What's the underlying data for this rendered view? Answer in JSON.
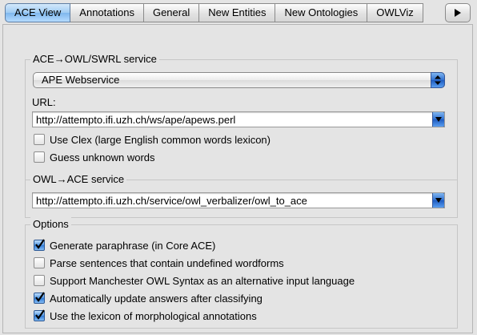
{
  "tabs": [
    {
      "label": "ACE View",
      "active": true
    },
    {
      "label": "Annotations",
      "active": false
    },
    {
      "label": "General",
      "active": false
    },
    {
      "label": "New Entities",
      "active": false
    },
    {
      "label": "New Ontologies",
      "active": false
    },
    {
      "label": "OWLViz",
      "active": false
    }
  ],
  "tab_scroll_icon": "triangle-right-icon",
  "ace_service": {
    "title": "ACE→OWL/SWRL service",
    "service_select": "APE Webservice",
    "url_label": "URL:",
    "url_value": "http://attempto.ifi.uzh.ch/ws/ape/apews.perl",
    "options": [
      {
        "label": "Use Clex (large English common words lexicon)",
        "checked": false
      },
      {
        "label": "Guess unknown words",
        "checked": false
      }
    ]
  },
  "owl_service": {
    "title": "OWL→ACE service",
    "url_value": "http://attempto.ifi.uzh.ch/service/owl_verbalizer/owl_to_ace"
  },
  "options": {
    "title": "Options",
    "items": [
      {
        "label": "Generate paraphrase (in Core ACE)",
        "checked": true
      },
      {
        "label": "Parse sentences that contain undefined wordforms",
        "checked": false
      },
      {
        "label": "Support Manchester OWL Syntax as an alternative input language",
        "checked": false
      },
      {
        "label": "Automatically update answers after classifying",
        "checked": true
      },
      {
        "label": "Use the lexicon of morphological annotations",
        "checked": true
      }
    ]
  },
  "colors": {
    "active_tab": "#9fcbf3",
    "checkbox_checked": "#2f7ad6",
    "background": "#e4e4e4"
  }
}
